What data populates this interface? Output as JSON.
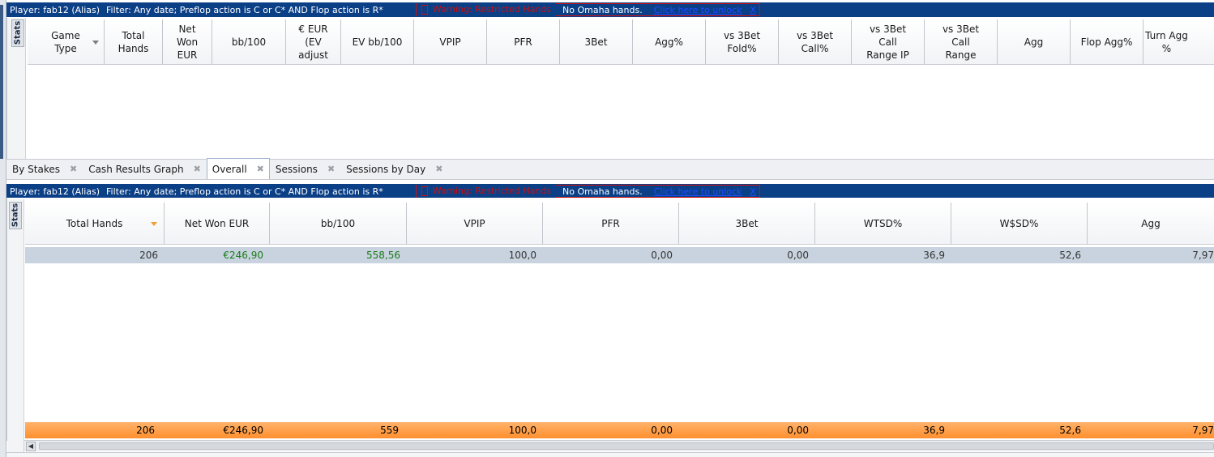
{
  "top_filter": {
    "player": "Player: fab12 (Alias)",
    "filter": "Filter: Any date; Preflop action is C or C* AND Flop action is R*",
    "warning": "Warning: Restricted Hands",
    "omaha": "No Omaha hands.",
    "unlock": "Click here to unlock",
    "close": "X"
  },
  "stats_label": "Stats",
  "top_columns": [
    {
      "label": "Game\nType"
    },
    {
      "label": "Total\nHands"
    },
    {
      "label": "Net\nWon\nEUR"
    },
    {
      "label": "bb/100"
    },
    {
      "label": "€ EUR\n(EV\nadjust"
    },
    {
      "label": "EV bb/100"
    },
    {
      "label": "VPIP"
    },
    {
      "label": "PFR"
    },
    {
      "label": "3Bet"
    },
    {
      "label": "Agg%"
    },
    {
      "label": "vs 3Bet\nFold%"
    },
    {
      "label": "vs 3Bet\nCall%"
    },
    {
      "label": "vs 3Bet\nCall\nRange IP"
    },
    {
      "label": "vs 3Bet\nCall\nRange"
    },
    {
      "label": "Agg"
    },
    {
      "label": "Flop Agg%"
    },
    {
      "label": "Turn Agg\n%"
    }
  ],
  "tabs": [
    {
      "label": "By Stakes",
      "close": "✖"
    },
    {
      "label": "Cash Results Graph",
      "close": "✖"
    },
    {
      "label": "Overall",
      "close": "✖"
    },
    {
      "label": "Sessions",
      "close": "✖"
    },
    {
      "label": "Sessions by Day",
      "close": "✖"
    }
  ],
  "bottom_filter": {
    "player": "Player: fab12 (Alias)",
    "filter": "Filter: Any date; Preflop action is C or C* AND Flop action is R*",
    "warning": "Warning: Restricted Hands",
    "omaha": "No Omaha hands.",
    "unlock": "Click here to unlock",
    "close": "X"
  },
  "bottom_columns": [
    {
      "label": "Total Hands"
    },
    {
      "label": "Net Won EUR"
    },
    {
      "label": "bb/100"
    },
    {
      "label": "VPIP"
    },
    {
      "label": "PFR"
    },
    {
      "label": "3Bet"
    },
    {
      "label": "WTSD%"
    },
    {
      "label": "W$SD%"
    },
    {
      "label": "Agg"
    }
  ],
  "data_row": [
    "206",
    "€246,90",
    "558,56",
    "100,0",
    "0,00",
    "0,00",
    "36,9",
    "52,6",
    "7,97"
  ],
  "total_row": [
    "206",
    "€246,90",
    "559",
    "100,0",
    "0,00",
    "0,00",
    "36,9",
    "52,6",
    "7,97"
  ],
  "colors": {
    "filter_bar": "#0b3f86",
    "warning": "#cc1010",
    "positive": "#1a7a1a",
    "total_row": "#ff8f2e",
    "sort_arrow": "#f0a030"
  }
}
